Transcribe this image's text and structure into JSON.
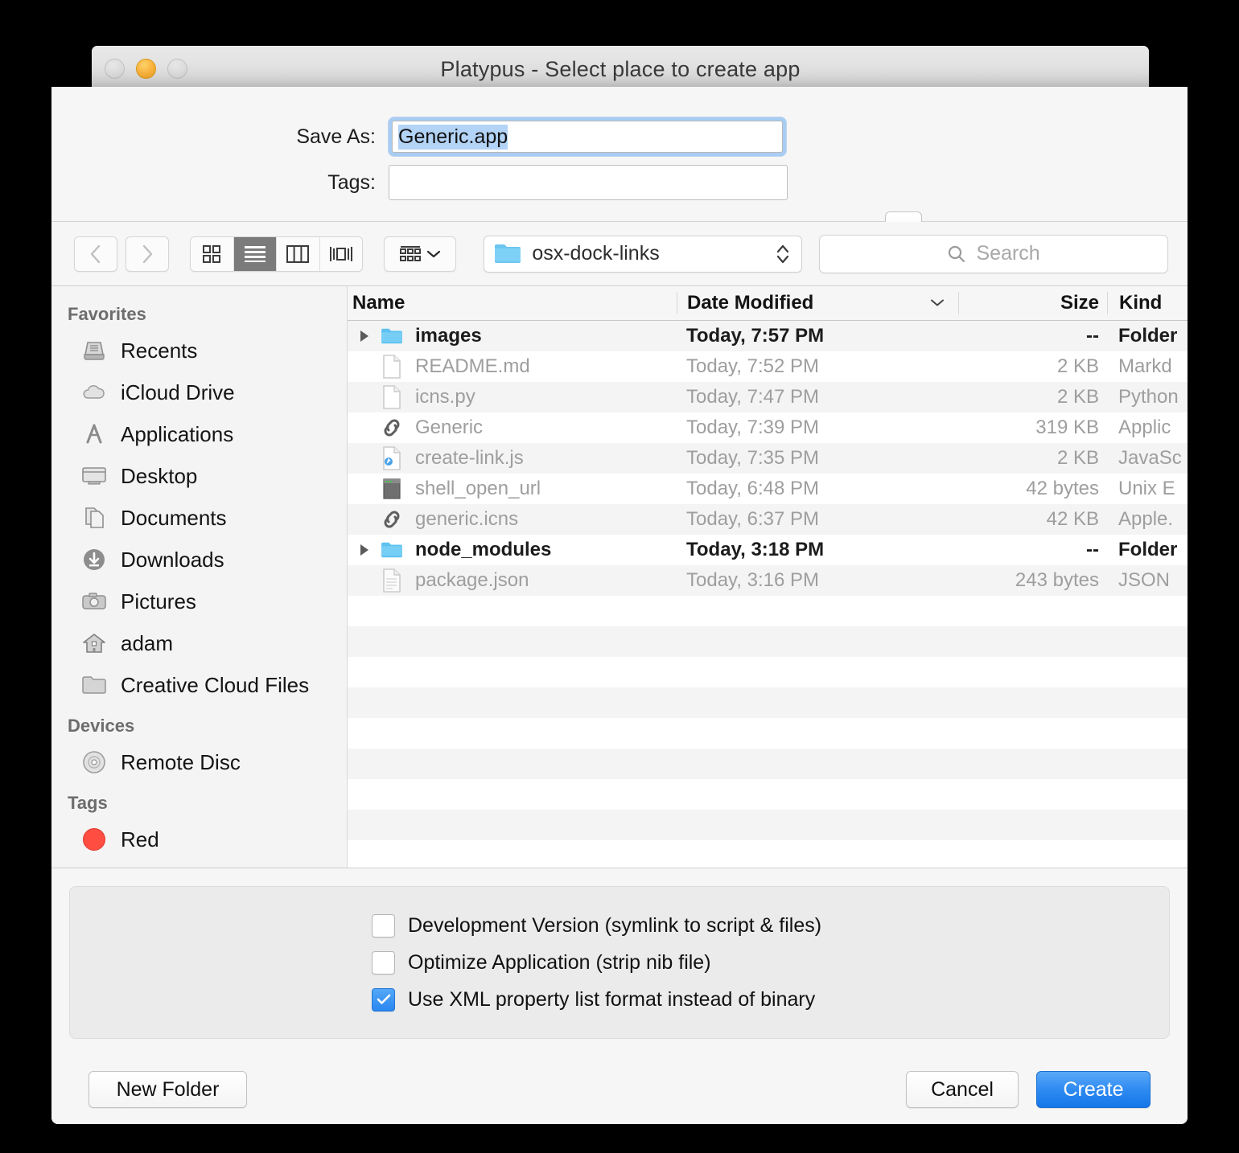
{
  "window": {
    "title": "Platypus - Select place to create app",
    "traffic_lights": [
      "close-button",
      "minimize-button",
      "zoom-button"
    ]
  },
  "save_panel": {
    "save_as_label": "Save As:",
    "save_as_value": "Generic.app",
    "tags_label": "Tags:",
    "tags_value": "",
    "tags_placeholder": "",
    "collapse_icon": "chevron-up-icon"
  },
  "toolbar": {
    "back_icon": "chevron-left-icon",
    "forward_icon": "chevron-right-icon",
    "view_modes": [
      {
        "name": "icon-view",
        "icon": "grid-icon",
        "active": false
      },
      {
        "name": "list-view",
        "icon": "list-icon",
        "active": true
      },
      {
        "name": "column-view",
        "icon": "columns-icon",
        "active": false
      },
      {
        "name": "gallery-view",
        "icon": "gallery-icon",
        "active": false
      }
    ],
    "arrange_icon": "arrange-icon",
    "arrange_chevron": "chevron-down-icon",
    "path_folder_icon": "folder-icon",
    "path_label": "osx-dock-links",
    "path_stepper_icon": "up-down-arrows-icon",
    "search_icon": "search-icon",
    "search_placeholder": "Search",
    "search_value": ""
  },
  "sidebar": {
    "sections": [
      {
        "header": "Favorites",
        "items": [
          {
            "label": "Recents",
            "icon": "recents-icon"
          },
          {
            "label": "iCloud Drive",
            "icon": "cloud-icon"
          },
          {
            "label": "Applications",
            "icon": "applications-icon"
          },
          {
            "label": "Desktop",
            "icon": "desktop-icon"
          },
          {
            "label": "Documents",
            "icon": "documents-icon"
          },
          {
            "label": "Downloads",
            "icon": "downloads-icon"
          },
          {
            "label": "Pictures",
            "icon": "camera-icon"
          },
          {
            "label": "adam",
            "icon": "home-icon"
          },
          {
            "label": "Creative Cloud Files",
            "icon": "folder-icon"
          }
        ]
      },
      {
        "header": "Devices",
        "items": [
          {
            "label": "Remote Disc",
            "icon": "disc-icon"
          }
        ]
      },
      {
        "header": "Tags",
        "items": [
          {
            "label": "Red",
            "icon": "red-tag-dot-icon"
          }
        ]
      }
    ]
  },
  "file_list": {
    "columns": [
      "Name",
      "Date Modified",
      "Size",
      "Kind"
    ],
    "sort_column": "Date Modified",
    "sort_indicator": "chevron-down-icon",
    "rows": [
      {
        "name": "images",
        "date": "Today, 7:57 PM",
        "size": "--",
        "kind": "Folder",
        "icon": "folder-icon",
        "expandable": true,
        "enabled": true
      },
      {
        "name": "README.md",
        "date": "Today, 7:52 PM",
        "size": "2 KB",
        "kind": "Markd",
        "icon": "document-icon",
        "expandable": false,
        "enabled": false
      },
      {
        "name": "icns.py",
        "date": "Today, 7:47 PM",
        "size": "2 KB",
        "kind": "Python",
        "icon": "document-icon",
        "expandable": false,
        "enabled": false
      },
      {
        "name": "Generic",
        "date": "Today, 7:39 PM",
        "size": "319 KB",
        "kind": "Applic",
        "icon": "alias-link-icon",
        "expandable": false,
        "enabled": false
      },
      {
        "name": "create-link.js",
        "date": "Today, 7:35 PM",
        "size": "2 KB",
        "kind": "JavaSc",
        "icon": "js-document-icon",
        "expandable": false,
        "enabled": false
      },
      {
        "name": "shell_open_url",
        "date": "Today, 6:48 PM",
        "size": "42 bytes",
        "kind": "Unix E",
        "icon": "terminal-icon",
        "expandable": false,
        "enabled": false
      },
      {
        "name": "generic.icns",
        "date": "Today, 6:37 PM",
        "size": "42 KB",
        "kind": "Apple.",
        "icon": "alias-link-icon",
        "expandable": false,
        "enabled": false
      },
      {
        "name": "node_modules",
        "date": "Today, 3:18 PM",
        "size": "--",
        "kind": "Folder",
        "icon": "folder-icon",
        "expandable": true,
        "enabled": true
      },
      {
        "name": "package.json",
        "date": "Today, 3:16 PM",
        "size": "243 bytes",
        "kind": "JSON",
        "icon": "lined-document-icon",
        "expandable": false,
        "enabled": false
      }
    ]
  },
  "options": {
    "checkboxes": [
      {
        "label": "Development Version (symlink to script & files)",
        "checked": false
      },
      {
        "label": "Optimize Application (strip nib file)",
        "checked": false
      },
      {
        "label": "Use XML property list format instead of binary",
        "checked": true
      }
    ]
  },
  "footer": {
    "new_folder_label": "New Folder",
    "cancel_label": "Cancel",
    "create_label": "Create"
  },
  "colors": {
    "accent_blue": "#2f8bf2",
    "selection_blue": "#b3d4f7",
    "focus_ring": "#a8cdf4",
    "folder_blue": "#6cc6f2",
    "tag_red": "#ff4d42",
    "minimize_yellow": "#f9b13a"
  }
}
